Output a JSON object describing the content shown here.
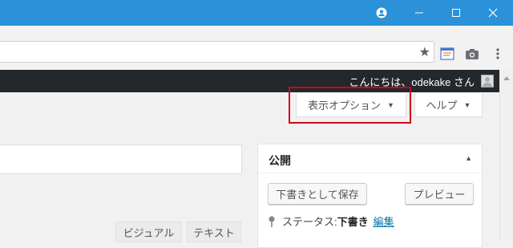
{
  "window": {
    "titlebar_color": "#2b91d8",
    "icons": [
      "account-icon",
      "minimize-icon",
      "maximize-icon",
      "close-icon"
    ]
  },
  "browser": {
    "star_icon": "★"
  },
  "adminbar": {
    "greeting": "こんにちは、odekake さん"
  },
  "screen_options": {
    "label": "表示オプション",
    "arrow": "▼",
    "highlight_color": "#d0021b"
  },
  "help": {
    "label": "ヘルプ",
    "arrow": "▼"
  },
  "publish_box": {
    "title": "公開",
    "toggle": "▲",
    "save_draft_label": "下書きとして保存",
    "preview_label": "プレビュー",
    "status_label": "ステータス: ",
    "status_value": "下書き",
    "edit_link": "編集"
  },
  "editor": {
    "visual_tab": "ビジュアル",
    "text_tab": "テキスト"
  }
}
